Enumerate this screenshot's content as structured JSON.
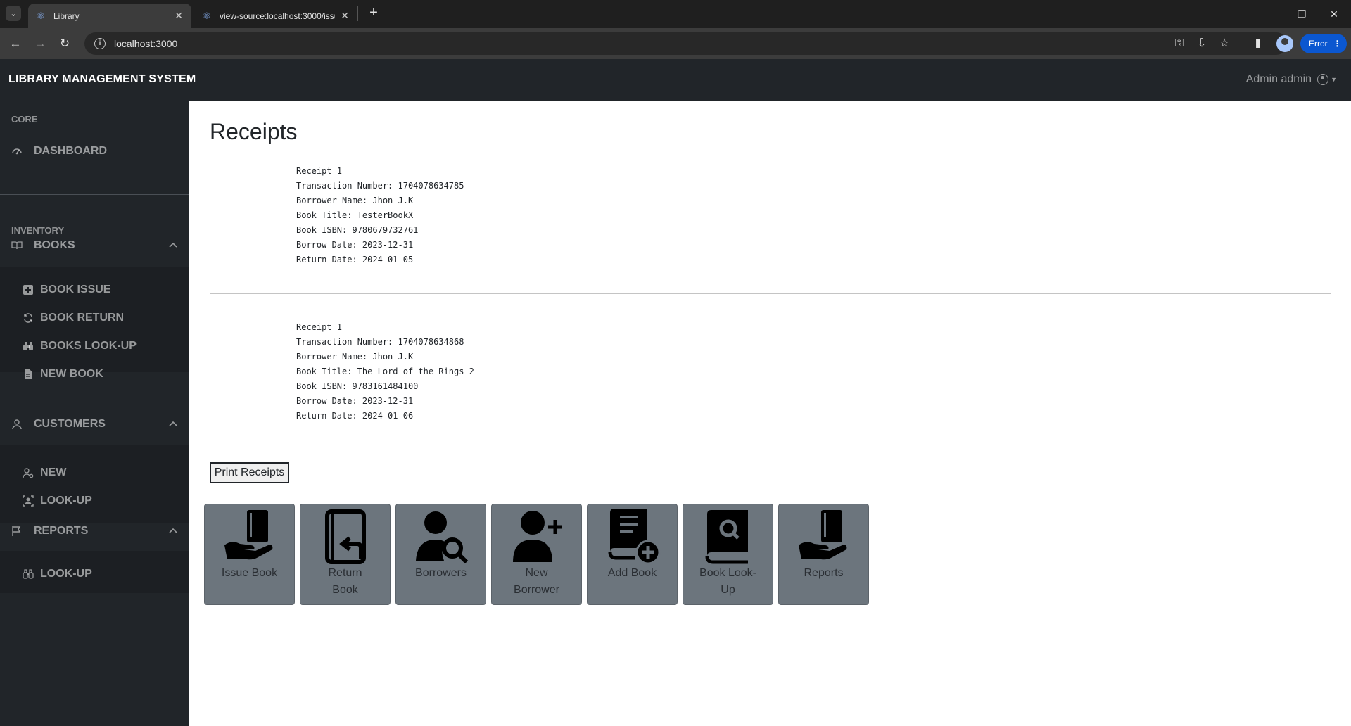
{
  "browser": {
    "tabs": [
      {
        "title": "Library",
        "active": true
      },
      {
        "title": "view-source:localhost:3000/issu",
        "active": false
      }
    ],
    "url": "localhost:3000",
    "error_label": "Error"
  },
  "app": {
    "brand": "LIBRARY MANAGEMENT SYSTEM",
    "user": "Admin admin"
  },
  "sidebar": {
    "core_heading": "CORE",
    "dashboard": "DASHBOARD",
    "inventory_heading": "INVENTORY",
    "books": {
      "label": "BOOKS",
      "items": [
        "BOOK ISSUE",
        "BOOK RETURN",
        "BOOKS LOOK-UP",
        "NEW BOOK"
      ]
    },
    "customers": {
      "label": "CUSTOMERS",
      "items": [
        "NEW",
        "LOOK-UP"
      ]
    },
    "reports": {
      "label": "REPORTS",
      "items": [
        "LOOK-UP"
      ]
    }
  },
  "main": {
    "title": "Receipts",
    "receipts": [
      {
        "heading": "Receipt 1",
        "transaction": "Transaction Number: 1704078634785",
        "borrower": "Borrower Name: Jhon J.K",
        "book_title": "Book Title: TesterBookX",
        "isbn": "Book ISBN: 9780679732761",
        "borrow_date": "Borrow Date: 2023-12-31",
        "return_date": "Return Date: 2024-01-05"
      },
      {
        "heading": "Receipt 1",
        "transaction": "Transaction Number: 1704078634868",
        "borrower": "Borrower Name: Jhon J.K",
        "book_title": "Book Title: The Lord of the Rings 2",
        "isbn": "Book ISBN: 9783161484100",
        "borrow_date": "Borrow Date: 2023-12-31",
        "return_date": "Return Date: 2024-01-06"
      }
    ],
    "print_button": "Print Receipts",
    "tiles": [
      {
        "label": "Issue Book",
        "icon": "hand-book-icon"
      },
      {
        "label": "Return Book",
        "icon": "book-return-icon"
      },
      {
        "label": "Borrowers",
        "icon": "user-search-icon"
      },
      {
        "label": "New Borrower",
        "icon": "user-plus-icon"
      },
      {
        "label": "Add Book",
        "icon": "book-add-icon"
      },
      {
        "label": "Book Look-Up",
        "icon": "book-search-icon"
      },
      {
        "label": "Reports",
        "icon": "hand-book-icon"
      }
    ]
  }
}
